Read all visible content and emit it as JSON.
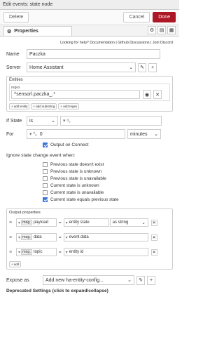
{
  "window": {
    "title": "Edit events: state node"
  },
  "toolbar": {
    "delete_label": "Delete",
    "cancel_label": "Cancel",
    "done_label": "Done"
  },
  "tabs": {
    "properties_label": "Properties"
  },
  "help": {
    "prefix": "Looking for help?",
    "doc_link": "Documentation",
    "sep1": " | ",
    "github_link": "Github Discussions",
    "sep2": " | ",
    "discord_link": "Join Discord"
  },
  "form": {
    "name_label": "Name",
    "name_value": "Paczka",
    "server_label": "Server",
    "server_value": "Home Assistant",
    "entities_title": "Entities",
    "regex_label": "regex",
    "regex_value": "^sensor\\.paczka_.*",
    "add_entity": "+ add entity",
    "add_substring": "+ add substring",
    "add_regex": "+ add regex",
    "if_state_label": "If State",
    "if_state_op": "is",
    "for_label": "For",
    "for_value": "0",
    "for_unit": "minutes",
    "output_on_connect": "Output on Connect",
    "ignore_title": "Ignore state change event when:",
    "ignore_options": [
      {
        "label": "Previous state doesn't exist",
        "checked": false
      },
      {
        "label": "Previous state is unknown",
        "checked": false
      },
      {
        "label": "Previous state is unavailable",
        "checked": false
      },
      {
        "label": "Current state is unknown",
        "checked": false
      },
      {
        "label": "Current state is unavailable",
        "checked": false
      },
      {
        "label": "Current state equals previous state",
        "checked": true
      }
    ]
  },
  "output_properties": {
    "title": "Output properties",
    "rows": [
      {
        "prefix": "msg.",
        "key": "payload",
        "eq": "=",
        "value": "entity state",
        "type": "as string"
      },
      {
        "prefix": "msg.",
        "key": "data",
        "eq": "=",
        "value": "event data"
      },
      {
        "prefix": "msg.",
        "key": "topic",
        "eq": "=",
        "value": "entity id"
      }
    ],
    "add_label": "+ add"
  },
  "expose": {
    "label": "Expose as",
    "value": "Add new ha-entity-config..."
  },
  "deprecated": {
    "label": "Deprecated Settings (click to expand/collapse)"
  }
}
